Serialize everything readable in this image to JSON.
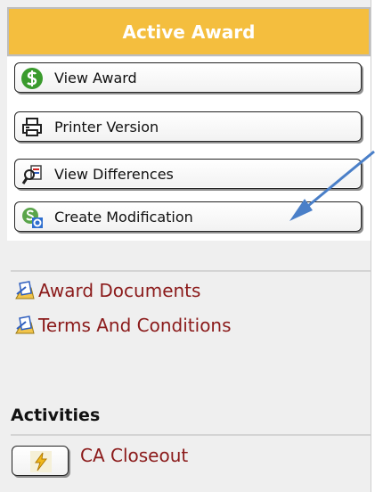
{
  "header": {
    "title": "Active Award"
  },
  "actions": [
    {
      "label": "View Award",
      "icon": "dollar-sign-icon"
    },
    {
      "label": "Printer Version",
      "icon": "printer-icon"
    },
    {
      "label": "View Differences",
      "icon": "compare-icon"
    },
    {
      "label": "Create Modification",
      "icon": "gear-dollar-icon"
    }
  ],
  "documents": [
    {
      "label": "Award Documents",
      "icon": "document-folder-icon"
    },
    {
      "label": "Terms And Conditions",
      "icon": "document-folder-icon"
    }
  ],
  "activities": {
    "title": "Activities",
    "items": [
      {
        "label": "CA Closeout",
        "icon": "lightning-icon"
      }
    ]
  },
  "colors": {
    "header_bg": "#f4be3e",
    "link": "#8b1a1a",
    "annotation_arrow": "#4a7fc8"
  }
}
